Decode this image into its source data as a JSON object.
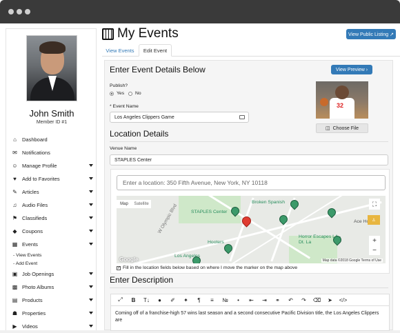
{
  "user": {
    "name": "John Smith",
    "member_id": "Member ID #1"
  },
  "sidebar": {
    "items": [
      {
        "label": "Dashboard",
        "icon": "home-icon",
        "glyph": "⌂",
        "caret": false
      },
      {
        "label": "Notifications",
        "icon": "envelope-icon",
        "glyph": "✉",
        "caret": false
      },
      {
        "label": "Manage Profile",
        "icon": "user-icon",
        "glyph": "☺",
        "caret": true
      },
      {
        "label": "Add to Favorites",
        "icon": "heart-icon",
        "glyph": "♥",
        "caret": true
      },
      {
        "label": "Articles",
        "icon": "pencil-icon",
        "glyph": "✎",
        "caret": true
      },
      {
        "label": "Audio Files",
        "icon": "music-icon",
        "glyph": "♫",
        "caret": true
      },
      {
        "label": "Classifieds",
        "icon": "pushpin-icon",
        "glyph": "⚑",
        "caret": true
      },
      {
        "label": "Coupons",
        "icon": "tag-icon",
        "glyph": "◆",
        "caret": true
      },
      {
        "label": "Events",
        "icon": "calendar-icon",
        "glyph": "▦",
        "caret": true
      }
    ],
    "sub_items": [
      "- View Events",
      "- Add Event"
    ],
    "items2": [
      {
        "label": "Job Openings",
        "icon": "briefcase-icon",
        "glyph": "▣",
        "caret": true
      },
      {
        "label": "Photo Albums",
        "icon": "image-icon",
        "glyph": "▩",
        "caret": true
      },
      {
        "label": "Products",
        "icon": "cart-icon",
        "glyph": "▤",
        "caret": true
      },
      {
        "label": "Properties",
        "icon": "building-icon",
        "glyph": "☗",
        "caret": true
      },
      {
        "label": "Videos",
        "icon": "video-icon",
        "glyph": "▶",
        "caret": true
      }
    ]
  },
  "header": {
    "title": "My Events",
    "public_listing": "View Public Listing ↗"
  },
  "tabs": [
    "View Events",
    "Edit Event"
  ],
  "form": {
    "heading": "Enter Event Details Below",
    "preview_button": "View Preview ›",
    "publish_label": "Publish?",
    "yes": "Yes",
    "no": "No",
    "event_name_label": "* Event Name",
    "event_name_value": "Los Angeles Clippers Game",
    "choose_file": "Choose File",
    "location_heading": "Location Details",
    "venue_label": "Venue Name",
    "venue_value": "STAPLES Center",
    "map_search_placeholder": "Enter a location: 350 Fifth Avenue, New York, NY 10118",
    "map_type_map": "Map",
    "map_type_satellite": "Satellite",
    "map_labels": [
      "STAPLES Center",
      "Broken Spanish",
      "Ace Hotel",
      "Horror Escapes LA - Dt. La",
      "Hooters",
      "Los Angeles",
      "W Olympic Blvd"
    ],
    "map_footer": "Map data ©2018 Google  Terms of Use",
    "google": "Google",
    "fill_checkbox_label": "Fill in the location fields below based on where I move the marker on the map above",
    "description_heading": "Enter Description",
    "description_text": "Coming off of a franchise-high 57 wins last season and a second consecutive Pacific Division title, the Los Angeles Clippers are"
  },
  "colors": {
    "accent": "#337ab7",
    "marker_red": "#e03c31",
    "marker_green": "#3c9a6a"
  }
}
